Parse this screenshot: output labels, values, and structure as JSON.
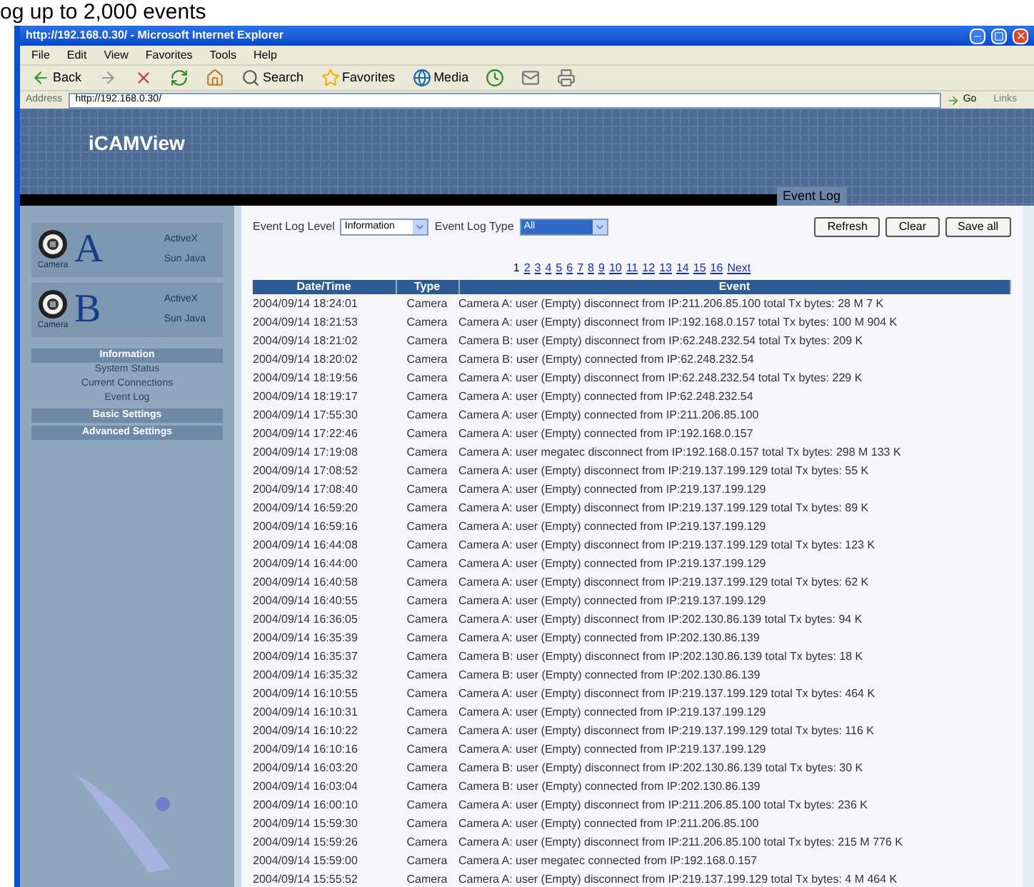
{
  "caption": "og up to 2,000 events",
  "window": {
    "title": "http://192.168.0.30/ - Microsoft Internet Explorer"
  },
  "menu": [
    "File",
    "Edit",
    "View",
    "Favorites",
    "Tools",
    "Help"
  ],
  "toolbar": {
    "back": "Back",
    "search": "Search",
    "favorites": "Favorites",
    "media": "Media"
  },
  "address_bar": {
    "label": "Address",
    "value": "http://192.168.0.30/",
    "go": "Go",
    "links": "Links"
  },
  "banner": {
    "logo": "iCAMView",
    "page_title": "Event Log"
  },
  "sidebar": {
    "cameras": [
      {
        "letter": "A",
        "caption": "Camera",
        "links": [
          "ActiveX",
          "Sun Java"
        ]
      },
      {
        "letter": "B",
        "caption": "Camera",
        "links": [
          "ActiveX",
          "Sun Java"
        ]
      }
    ],
    "sections": [
      {
        "title": "Information",
        "items": [
          "System Status",
          "Current Connections",
          "Event Log"
        ]
      },
      {
        "title": "Basic Settings"
      },
      {
        "title": "Advanced Settings"
      }
    ]
  },
  "filters": [
    {
      "label": "Event Log Level",
      "value": "Information",
      "focused": false
    },
    {
      "label": "Event Log Type",
      "value": "All",
      "focused": true
    }
  ],
  "buttons": [
    "Refresh",
    "Clear",
    "Save all"
  ],
  "pagination": {
    "pages": [
      {
        "label": "1",
        "selected": true
      },
      {
        "label": "2",
        "selected": false
      },
      {
        "label": "3",
        "selected": false
      },
      {
        "label": "4",
        "selected": false
      },
      {
        "label": "5",
        "selected": false
      },
      {
        "label": "6",
        "selected": false
      },
      {
        "label": "7",
        "selected": false
      },
      {
        "label": "8",
        "selected": false
      },
      {
        "label": "9",
        "selected": false
      },
      {
        "label": "10",
        "selected": false
      },
      {
        "label": "11",
        "selected": false
      },
      {
        "label": "12",
        "selected": false
      },
      {
        "label": "13",
        "selected": false
      },
      {
        "label": "14",
        "selected": false
      },
      {
        "label": "15",
        "selected": false
      },
      {
        "label": "16",
        "selected": false
      }
    ],
    "next": "Next"
  },
  "table": {
    "columns": [
      "Date/Time",
      "Type",
      "Event"
    ],
    "rows": [
      [
        "2004/09/14 18:24:01",
        "Camera",
        "Camera A: user (Empty) disconnect from IP:211.206.85.100 total Tx bytes: 28 M 7 K"
      ],
      [
        "2004/09/14 18:21:53",
        "Camera",
        "Camera A: user (Empty) disconnect from IP:192.168.0.157 total Tx bytes: 100 M 904 K"
      ],
      [
        "2004/09/14 18:21:02",
        "Camera",
        "Camera B: user (Empty) disconnect from IP:62.248.232.54 total Tx bytes: 209 K"
      ],
      [
        "2004/09/14 18:20:02",
        "Camera",
        "Camera B: user (Empty) connected from IP:62.248.232.54"
      ],
      [
        "2004/09/14 18:19:56",
        "Camera",
        "Camera A: user (Empty) disconnect from IP:62.248.232.54 total Tx bytes: 229 K"
      ],
      [
        "2004/09/14 18:19:17",
        "Camera",
        "Camera A: user (Empty) connected from IP:62.248.232.54"
      ],
      [
        "2004/09/14 17:55:30",
        "Camera",
        "Camera A: user (Empty) connected from IP:211.206.85.100"
      ],
      [
        "2004/09/14 17:22:46",
        "Camera",
        "Camera A: user (Empty) connected from IP:192.168.0.157"
      ],
      [
        "2004/09/14 17:19:08",
        "Camera",
        "Camera A: user megatec disconnect from IP:192.168.0.157 total Tx bytes: 298 M 133 K"
      ],
      [
        "2004/09/14 17:08:52",
        "Camera",
        "Camera A: user (Empty) disconnect from IP:219.137.199.129 total Tx bytes: 55 K"
      ],
      [
        "2004/09/14 17:08:40",
        "Camera",
        "Camera A: user (Empty) connected from IP:219.137.199.129"
      ],
      [
        "2004/09/14 16:59:20",
        "Camera",
        "Camera A: user (Empty) disconnect from IP:219.137.199.129 total Tx bytes: 89 K"
      ],
      [
        "2004/09/14 16:59:16",
        "Camera",
        "Camera A: user (Empty) connected from IP:219.137.199.129"
      ],
      [
        "2004/09/14 16:44:08",
        "Camera",
        "Camera A: user (Empty) disconnect from IP:219.137.199.129 total Tx bytes: 123 K"
      ],
      [
        "2004/09/14 16:44:00",
        "Camera",
        "Camera A: user (Empty) connected from IP:219.137.199.129"
      ],
      [
        "2004/09/14 16:40:58",
        "Camera",
        "Camera A: user (Empty) disconnect from IP:219.137.199.129 total Tx bytes: 62 K"
      ],
      [
        "2004/09/14 16:40:55",
        "Camera",
        "Camera A: user (Empty) connected from IP:219.137.199.129"
      ],
      [
        "2004/09/14 16:36:05",
        "Camera",
        "Camera A: user (Empty) disconnect from IP:202.130.86.139 total Tx bytes: 94 K"
      ],
      [
        "2004/09/14 16:35:39",
        "Camera",
        "Camera A: user (Empty) connected from IP:202.130.86.139"
      ],
      [
        "2004/09/14 16:35:37",
        "Camera",
        "Camera B: user (Empty) disconnect from IP:202.130.86.139 total Tx bytes: 18 K"
      ],
      [
        "2004/09/14 16:35:32",
        "Camera",
        "Camera B: user (Empty) connected from IP:202.130.86.139"
      ],
      [
        "2004/09/14 16:10:55",
        "Camera",
        "Camera A: user (Empty) disconnect from IP:219.137.199.129 total Tx bytes: 464 K"
      ],
      [
        "2004/09/14 16:10:31",
        "Camera",
        "Camera A: user (Empty) connected from IP:219.137.199.129"
      ],
      [
        "2004/09/14 16:10:22",
        "Camera",
        "Camera A: user (Empty) disconnect from IP:219.137.199.129 total Tx bytes: 116 K"
      ],
      [
        "2004/09/14 16:10:16",
        "Camera",
        "Camera A: user (Empty) connected from IP:219.137.199.129"
      ],
      [
        "2004/09/14 16:03:20",
        "Camera",
        "Camera B: user (Empty) disconnect from IP:202.130.86.139 total Tx bytes: 30 K"
      ],
      [
        "2004/09/14 16:03:04",
        "Camera",
        "Camera B: user (Empty) connected from IP:202.130.86.139"
      ],
      [
        "2004/09/14 16:00:10",
        "Camera",
        "Camera A: user (Empty) disconnect from IP:211.206.85.100 total Tx bytes: 236 K"
      ],
      [
        "2004/09/14 15:59:30",
        "Camera",
        "Camera A: user (Empty) connected from IP:211.206.85.100"
      ],
      [
        "2004/09/14 15:59:26",
        "Camera",
        "Camera A: user (Empty) disconnect from IP:211.206.85.100 total Tx bytes: 215 M 776 K"
      ],
      [
        "2004/09/14 15:59:00",
        "Camera",
        "Camera A: user megatec connected from IP:192.168.0.157"
      ],
      [
        "2004/09/14 15:55:52",
        "Camera",
        "Camera A: user (Empty) disconnect from IP:219.137.199.129 total Tx bytes: 4 M 464 K"
      ]
    ]
  }
}
